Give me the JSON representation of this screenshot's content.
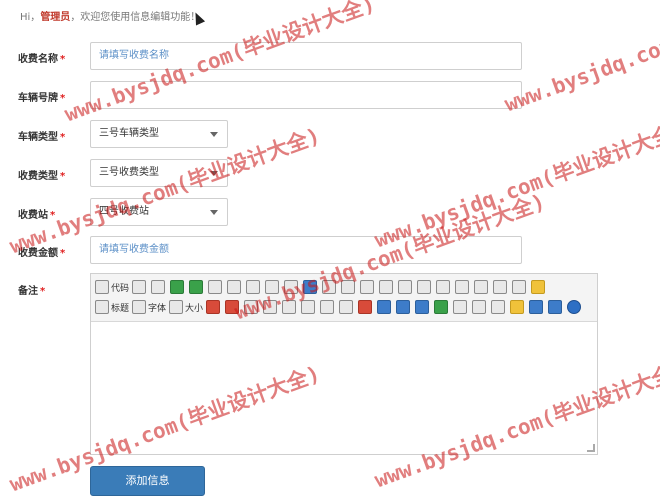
{
  "greeting": {
    "prefix": "Hi，",
    "user": "管理员",
    "suffix": "，欢迎您使用信息编辑功能！"
  },
  "form": {
    "fee_name": {
      "label": "收费名称",
      "placeholder": "请填写收费名称"
    },
    "plate": {
      "label": "车辆号牌",
      "value": ""
    },
    "vehicle_type": {
      "label": "车辆类型",
      "value": "三号车辆类型"
    },
    "fee_type": {
      "label": "收费类型",
      "value": "三号收费类型"
    },
    "station": {
      "label": "收费站",
      "value": "四号收费站"
    },
    "amount": {
      "label": "收费金额",
      "placeholder": "请填写收费金额"
    },
    "note": {
      "label": "备注"
    },
    "required_mark": "*",
    "submit_label": "添加信息"
  },
  "editor": {
    "row1": [
      {
        "icon": "code-icon",
        "label": "代码"
      },
      {
        "icon": "search-icon"
      },
      {
        "icon": "table-icon"
      },
      {
        "icon": "chat-icon"
      },
      {
        "icon": "cloud-icon"
      },
      {
        "icon": "print-icon"
      },
      {
        "icon": "cut-icon"
      },
      {
        "icon": "copy-icon"
      },
      {
        "icon": "paste-icon"
      },
      {
        "icon": "paste-text-icon"
      },
      {
        "icon": "image-icon"
      },
      {
        "icon": "align-left-icon"
      },
      {
        "icon": "align-center-icon"
      },
      {
        "icon": "align-right-icon"
      },
      {
        "icon": "justify-icon"
      },
      {
        "icon": "list-icon"
      },
      {
        "icon": "ordered-list-icon"
      },
      {
        "icon": "indent-icon"
      },
      {
        "icon": "outdent-icon"
      },
      {
        "icon": "subscript-icon"
      },
      {
        "icon": "superscript-icon"
      },
      {
        "icon": "calendar-icon"
      },
      {
        "icon": "clock-icon"
      }
    ],
    "row2": [
      {
        "icon": "heading-icon",
        "label": "标题"
      },
      {
        "icon": "font-icon",
        "label": "字体"
      },
      {
        "icon": "size-icon",
        "label": "大小"
      },
      {
        "icon": "char-icon"
      },
      {
        "icon": "special-char-icon"
      },
      {
        "icon": "bold-icon"
      },
      {
        "icon": "italic-icon"
      },
      {
        "icon": "underline-icon"
      },
      {
        "icon": "strike-icon"
      },
      {
        "icon": "line-icon"
      },
      {
        "icon": "eraser-icon"
      },
      {
        "icon": "border-icon"
      },
      {
        "icon": "flash-icon"
      },
      {
        "icon": "media-icon"
      },
      {
        "icon": "map-icon"
      },
      {
        "icon": "fullscreen-icon"
      },
      {
        "icon": "select-all-icon"
      },
      {
        "icon": "spellcheck-icon"
      },
      {
        "icon": "hr-icon"
      },
      {
        "icon": "emoticon-icon"
      },
      {
        "icon": "link-icon"
      },
      {
        "icon": "unlink-icon"
      },
      {
        "icon": "info-icon"
      }
    ]
  },
  "watermark": "www.bysjdq.com(毕业设计大全)",
  "colors": {
    "required": "#e02020",
    "button": "#3a7cb8",
    "placeholder": "#5b8fc7",
    "admin": "#c0392b",
    "watermark": "#c81414"
  }
}
